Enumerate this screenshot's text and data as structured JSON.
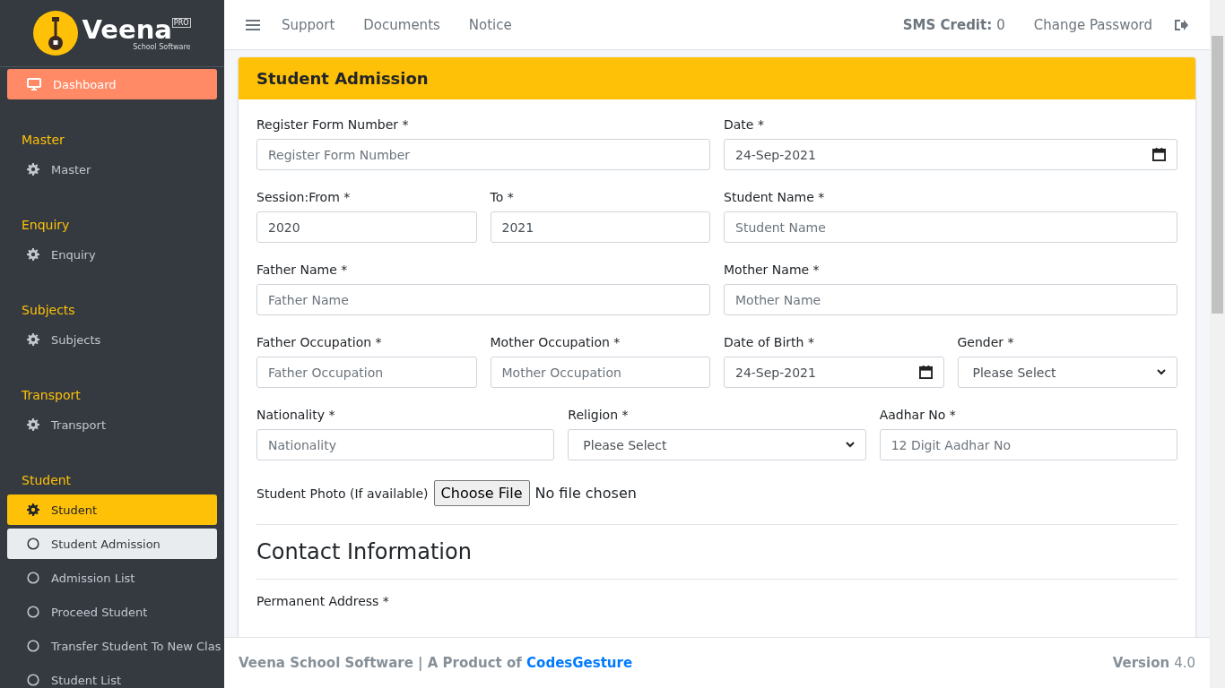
{
  "brand": {
    "name": "Veena",
    "badge": "PRO",
    "tagline": "School Software"
  },
  "sidebar": {
    "items": [
      {
        "kind": "link",
        "label": "Dashboard",
        "selected": true
      },
      {
        "kind": "header",
        "label": "Master"
      },
      {
        "kind": "link",
        "label": "Master",
        "selected": false
      },
      {
        "kind": "header",
        "label": "Enquiry"
      },
      {
        "kind": "link",
        "label": "Enquiry",
        "selected": false
      },
      {
        "kind": "header",
        "label": "Subjects"
      },
      {
        "kind": "link",
        "label": "Subjects",
        "selected": false
      },
      {
        "kind": "header",
        "label": "Transport"
      },
      {
        "kind": "link",
        "label": "Transport",
        "selected": false
      },
      {
        "kind": "header",
        "label": "Student"
      },
      {
        "kind": "group",
        "label": "Student",
        "selected": true,
        "children": [
          {
            "label": "Student Admission",
            "selected": true
          },
          {
            "label": "Admission List",
            "selected": false
          },
          {
            "label": "Proceed Student",
            "selected": false
          },
          {
            "label": "Transfer Student To New Clas",
            "selected": false
          },
          {
            "label": "Student List",
            "selected": false
          }
        ]
      }
    ]
  },
  "topbar": {
    "links": [
      "Support",
      "Documents",
      "Notice"
    ],
    "credit_label": "SMS Credit:",
    "credit_value": "0",
    "change_password": "Change Password"
  },
  "card": {
    "title": "Student Admission",
    "rows": [
      [
        {
          "label": "Register Form Number *",
          "kind": "text",
          "placeholder": "Register Form Number"
        },
        {
          "label": "Date *",
          "kind": "date",
          "value": "24-Sep-2021"
        }
      ],
      [
        {
          "group": [
            {
              "label": "Session:From *",
              "kind": "text",
              "value": "2020"
            },
            {
              "label": "To *",
              "kind": "text",
              "value": "2021"
            }
          ]
        },
        {
          "label": "Student Name *",
          "kind": "text",
          "placeholder": "Student Name"
        }
      ],
      [
        {
          "label": "Father Name *",
          "kind": "text",
          "placeholder": "Father Name"
        },
        {
          "label": "Mother Name *",
          "kind": "text",
          "placeholder": "Mother Name"
        }
      ],
      [
        {
          "group": [
            {
              "label": "Father Occupation *",
              "kind": "text",
              "placeholder": "Father Occupation"
            },
            {
              "label": "Mother Occupation *",
              "kind": "text",
              "placeholder": "Mother Occupation"
            }
          ]
        },
        {
          "group": [
            {
              "label": "Date of Birth *",
              "kind": "date",
              "value": "24-Sep-2021"
            },
            {
              "label": "Gender *",
              "kind": "select",
              "value": "Please Select"
            }
          ]
        }
      ],
      [
        {
          "label": "Nationality *",
          "kind": "text",
          "placeholder": "Nationality"
        },
        {
          "label": "Religion *",
          "kind": "select",
          "value": "Please Select"
        },
        {
          "label": "Aadhar No *",
          "kind": "text",
          "placeholder": "12 Digit Aadhar No"
        }
      ]
    ],
    "photo": {
      "label": "Student Photo (If available)",
      "button": "Choose File",
      "status": "No file chosen"
    },
    "section_title": "Contact Information",
    "next_label": "Permanent Address *"
  },
  "footer": {
    "text": "Veena School Software | A Product of",
    "link": "CodesGesture",
    "version_label": "Version",
    "version": "4.0"
  }
}
